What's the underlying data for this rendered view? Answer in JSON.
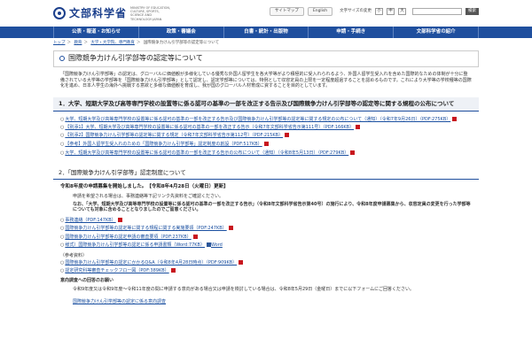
{
  "header": {
    "logo_text": "文部科学省",
    "logo_sub": "MINISTRY OF EDUCATION, CULTURE, SPORTS, SCIENCE AND TECHNOLOGY-JAPAN",
    "sitemap": "サイトマップ",
    "english": "English",
    "font_size_label": "文字サイズの変更",
    "font_small": "小",
    "font_mid": "中",
    "font_large": "大",
    "search_btn": "検索"
  },
  "nav": {
    "items": [
      {
        "label": "公表・報道・お知らせ"
      },
      {
        "label": "政策・審議会"
      },
      {
        "label": "白書・統計・出版物"
      },
      {
        "label": "申請・手続き"
      },
      {
        "label": "文部科学省の紹介"
      }
    ]
  },
  "breadcrumb": [
    "トップ",
    "教育",
    "大学・大学院、専門教育",
    "国際競争力けん引学部等の認定等について"
  ],
  "page": {
    "title": "国際競争力けん引学部等の認定等について",
    "intro": "「国際競争力けん引学部等」の認定は、グローバルに価値観が多様化している優秀な外国人留学生を各大学等がより積極的に受入れられるよう、外国人留学生受入れを含めた国際的なための体制が十分に整備されている大学等の学部等を「国際競争力けん引学部等」として認定し、認定学部等については、特例として収容定員の上限を一定程度超過することを認めるものです。これにより大学等の学校種等の国際化を進め、日本人学生の海外へ挑戦する意欲と多様な価値観を育成し、我が国のグローバル人材育成に資することを目的としています。"
  },
  "section1": {
    "heading": "1．大学、短期大学及び高等専門学校の設置等に係る認可の基準の一部を改正する告示及び国際競争力けん引学部等の認定等に関する規程の公布について",
    "items": [
      {
        "text": "大学、短期大学及び高等専門学校の設置等に係る認可の基準の一部を改正する告示及び国際競争力けん引学部等の認定等に関する規定の公布について（通知）（令和7年9月26日）（PDF:275KB）",
        "icon": "pdf"
      },
      {
        "text": "【別添1】大学、短期大学及び高等専門学校の設置等に係る認可の基準の一部を改正する告示（令和7年文部科学省告示第111号）（PDF:166KB）",
        "icon": "pdf"
      },
      {
        "text": "【別添2】国際競争力けん引学部等の認定等に関する規定（令和7年文部科学省告示第112号）（PDF:215KB）",
        "icon": "pdf"
      },
      {
        "text": "【参考】外国人留学生受入れのための「国際競争力けん引学部等」認定制度の創設（PDF:517KB）",
        "icon": "pdf"
      },
      {
        "text": "大学、短期大学及び高等専門学校の設置等に係る認可の基準の一部を改正する告示の公布について（通知）（令和8年5月13日）（PDF:279KB）",
        "icon": "pdf"
      }
    ]
  },
  "section2": {
    "heading": "2．「国際競争力けん引学部等」認定制度について",
    "sub_head": "令和8年度の申請募集を開始しました。【令和8年4月28日（火曜日）更新】",
    "para1": "申請を希望される場合は、事務連絡等下記リンク先資料をご確認ください。",
    "para2": "なお、「大学、短期大学及び高等専門学校の設置等に係る認可の基準の一部を改正する告示」（令和8年文部科学省告示第40号）の施行により、令和8年度申請募集から、収容定員の変更を行った学部等についても対象に含めることとなりましたのでご留意ください。",
    "links": [
      {
        "text": "事務連絡（PDF:147KB）",
        "icon": "pdf"
      },
      {
        "text": "国際競争力けん引学部等の認定等に関する規程に関する実施要領（PDF:247KB）",
        "icon": "pdf"
      },
      {
        "text": "国際競争力けん引学部等の認定申請の審査要項（PDF:237KB）",
        "icon": "pdf"
      },
      {
        "text": "様式）国際競争力けん引学部等の認定に係る申請書類（Word:77KB）",
        "icon": "word"
      }
    ],
    "word_label": "Word",
    "ref_head": "（参考資料）",
    "refs": [
      {
        "text": "国際競争力けん引学部等の認定にかかるQ&A（令和8年4月28日時点）（PDF:909KB）",
        "icon": "pdf"
      },
      {
        "text": "認定研究科等審査チェックフロー図（PDF:389KB）",
        "icon": "pdf"
      }
    ],
    "survey_head": "意向調査への回答のお願い",
    "survey_text": "令和9年度又は令和9年度～令和11年度の間に申請する意向がある場合又は申請を検討している場合は、令和8年5月29日（金曜日）までに以下フォームにご回答ください。",
    "survey_link": "国際競争力けん引学部等の認定に係る意向調査"
  }
}
